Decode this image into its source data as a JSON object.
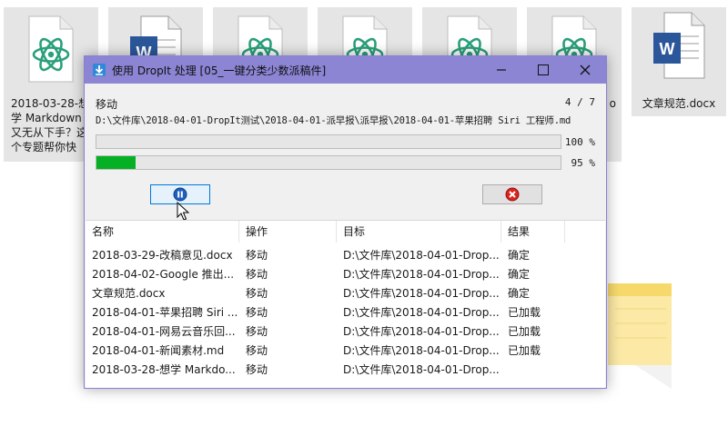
{
  "desktop": {
    "tiles": [
      {
        "type": "atom",
        "caption": [
          "2018-03-28-想",
          "学 Markdown",
          "又无从下手？这",
          "个专题帮你快"
        ]
      },
      {
        "type": "word",
        "caption": []
      },
      {
        "type": "atom",
        "caption": []
      },
      {
        "type": "atom",
        "caption": []
      },
      {
        "type": "atom",
        "caption": []
      },
      {
        "type": "atom",
        "caption": [
          "",
          "o"
        ]
      }
    ],
    "right_file_caption": "文章规范.docx",
    "colors": {
      "atom": "#2aa07a",
      "word": "#2b579a"
    }
  },
  "dialog": {
    "title": "使用 DropIt 处理 [05_一键分类少数派稿件]",
    "operation": "移动",
    "counter": "4 / 7",
    "path": "D:\\文件库\\2018-04-01-DropIt测试\\2018-04-01-派早报\\派早报\\2018-04-01-苹果招聘 Siri 工程师.md",
    "progress": [
      {
        "value": 100,
        "label": "100 %"
      },
      {
        "value": 95,
        "label": "95 %"
      }
    ],
    "accent": "#8b85d4",
    "progress_color": "#06b025"
  },
  "list": {
    "columns": [
      "名称",
      "操作",
      "目标",
      "结果"
    ],
    "rows": [
      [
        "2018-03-29-改稿意见.docx",
        "移动",
        "D:\\文件库\\2018-04-01-Drop...",
        "确定"
      ],
      [
        "2018-04-02-Google 推出...",
        "移动",
        "D:\\文件库\\2018-04-01-Drop...",
        "确定"
      ],
      [
        "文章规范.docx",
        "移动",
        "D:\\文件库\\2018-04-01-Drop...",
        "确定"
      ],
      [
        "2018-04-01-苹果招聘 Siri ...",
        "移动",
        "D:\\文件库\\2018-04-01-Drop...",
        "已加载"
      ],
      [
        "2018-04-01-网易云音乐回...",
        "移动",
        "D:\\文件库\\2018-04-01-Drop...",
        "已加载"
      ],
      [
        "2018-04-01-新闻素材.md",
        "移动",
        "D:\\文件库\\2018-04-01-Drop...",
        "已加载"
      ],
      [
        "2018-03-28-想学 Markdo...",
        "移动",
        "D:\\文件库\\2018-04-01-Drop...",
        ""
      ]
    ]
  }
}
